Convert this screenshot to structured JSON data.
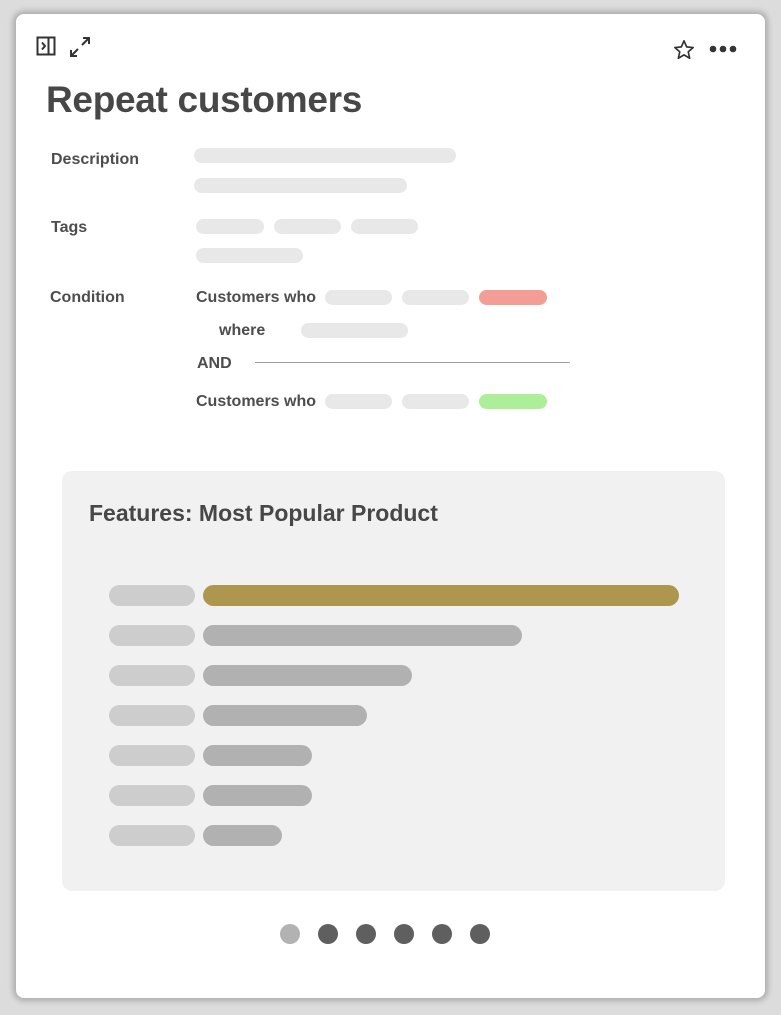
{
  "header": {
    "title": "Repeat customers",
    "icons": [
      "sidebar-toggle-icon",
      "expand-icon",
      "star-icon",
      "more-icon"
    ]
  },
  "fields": {
    "description_label": "Description",
    "tags_label": "Tags",
    "condition_label": "Condition"
  },
  "condition": {
    "clause1": "Customers who",
    "where": "where",
    "operator": "AND",
    "clause2": "Customers who",
    "colors": {
      "negative": "#f29d95",
      "positive": "#acef98"
    }
  },
  "feature": {
    "title": "Features: Most Popular Product",
    "highlight_color": "#ad974f",
    "bar_color": "#b1b1b1",
    "levels": [
      1.0,
      0.67,
      0.44,
      0.345,
      0.23,
      0.23,
      0.165
    ],
    "highlighted_index": 0
  },
  "pagination": {
    "count": 6,
    "active_index": 0
  }
}
